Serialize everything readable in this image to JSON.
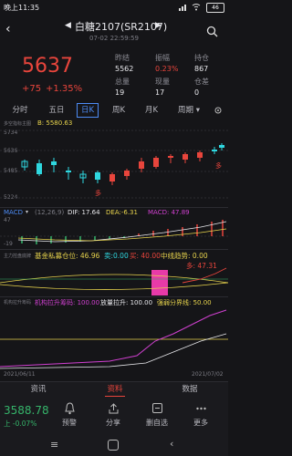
{
  "status_bar": {
    "time": "晚上11:35",
    "battery": "46"
  },
  "header": {
    "title": "白糖2107(SR2107)",
    "timestamp": "07-02 22:59:59"
  },
  "quote": {
    "price": "5637",
    "change": "+75",
    "change_pct": "+1.35%",
    "stats": [
      {
        "label": "昨结",
        "value": "5562"
      },
      {
        "label": "振幅",
        "value": "0.23%"
      },
      {
        "label": "持仓",
        "value": "867"
      },
      {
        "label": "总量",
        "value": "19"
      },
      {
        "label": "现量",
        "value": "17"
      },
      {
        "label": "仓差",
        "value": "0"
      }
    ]
  },
  "period_tabs": [
    "分时",
    "五日",
    "日K",
    "周K",
    "月K",
    "周期"
  ],
  "active_period": "日K",
  "main_chart": {
    "legend_small": "多空指标主图",
    "bias_label": "B: 5580.63",
    "y_labels": [
      "5734",
      "5636",
      "5485",
      "5224"
    ],
    "marker_text": "多",
    "right_marker": "多"
  },
  "macd": {
    "label": "MACD",
    "params": "(12,26,9)",
    "dif": "DIF: 17.64",
    "dea": "DEA:-6.31",
    "macd_val": "MACD: 47.89",
    "y_labels": [
      "47",
      "-19"
    ]
  },
  "fund": {
    "small_label": "主力控盘底牌",
    "text1": "基金私募仓位: 46.96",
    "text2": "卖:0.00",
    "text3": "买: 40.00",
    "text4": "中线趋势: 0.00",
    "text5": "多: 47.31"
  },
  "lift": {
    "small_label": "机构拉升筹码",
    "text1": "机构拉升筹码: 100.00",
    "text2": "放量拉升: 100.00",
    "text3": "强弱分界线: 50.00"
  },
  "dates": {
    "start": "2021/06/11",
    "end": "2021/07/02"
  },
  "content_tabs": [
    "资讯",
    "资料",
    "数据"
  ],
  "active_content_tab": "资料",
  "bottom": {
    "price": "3588.78",
    "change": "上 -0.07%",
    "items": [
      {
        "label": "预警",
        "icon": "bell-icon"
      },
      {
        "label": "分享",
        "icon": "share-icon"
      },
      {
        "label": "删自选",
        "icon": "remove-watchlist-icon"
      },
      {
        "label": "更多",
        "icon": "more-icon"
      }
    ]
  },
  "colors": {
    "up": "#e8453c",
    "down": "#35b46a",
    "accent": "#4d8cf5",
    "cyan": "#2fd8e0"
  }
}
